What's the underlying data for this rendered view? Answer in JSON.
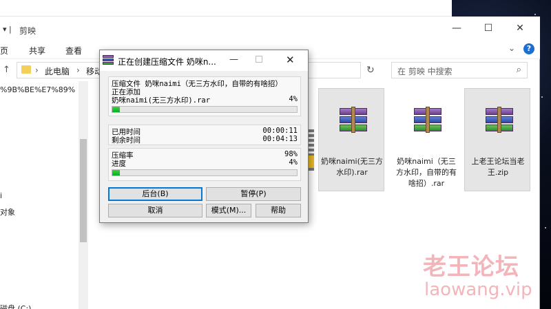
{
  "explorer": {
    "title": "剪映",
    "ribbon_tabs": [
      "页",
      "共享",
      "查看"
    ],
    "address": {
      "crumb1": "此电脑",
      "crumb2": "移动"
    },
    "search_placeholder": "在 剪映 中搜索",
    "left_pane": [
      "%9B%BE%E7%89%",
      "i",
      "对象",
      "磁盘 (C:)"
    ]
  },
  "files": [
    {
      "label": "奶咪naimi(无三方水印).rar",
      "selected": true
    },
    {
      "label": "奶咪naimi（无三方水印，自带的有啥招）.rar",
      "selected": false
    },
    {
      "label": "上老王论坛当老王.zip",
      "selected": true
    }
  ],
  "dialog": {
    "title": "正在创建压缩文件 奶咪n...",
    "compress_file_line": "压缩文件 奶咪naimi（无三方水印，自带的有啥招）",
    "adding_label": "正在添加",
    "adding_file": "奶咪naimi(无三方水印).rar",
    "file_percent": "4%",
    "file_progress": 0.04,
    "elapsed_label": "已用时间",
    "elapsed_value": "00:00:11",
    "remaining_label": "剩余时间",
    "remaining_value": "00:04:13",
    "ratio_label": "压缩率",
    "ratio_value": "98%",
    "progress_label": "进度",
    "progress_value": "4%",
    "total_progress": 0.04,
    "buttons": {
      "background": "后台(B)",
      "pause": "暂停(P)",
      "cancel": "取消",
      "mode": "模式(M)...",
      "help": "帮助"
    }
  },
  "watermark": {
    "line1": "老王论坛",
    "line2": "laowang.vip"
  }
}
